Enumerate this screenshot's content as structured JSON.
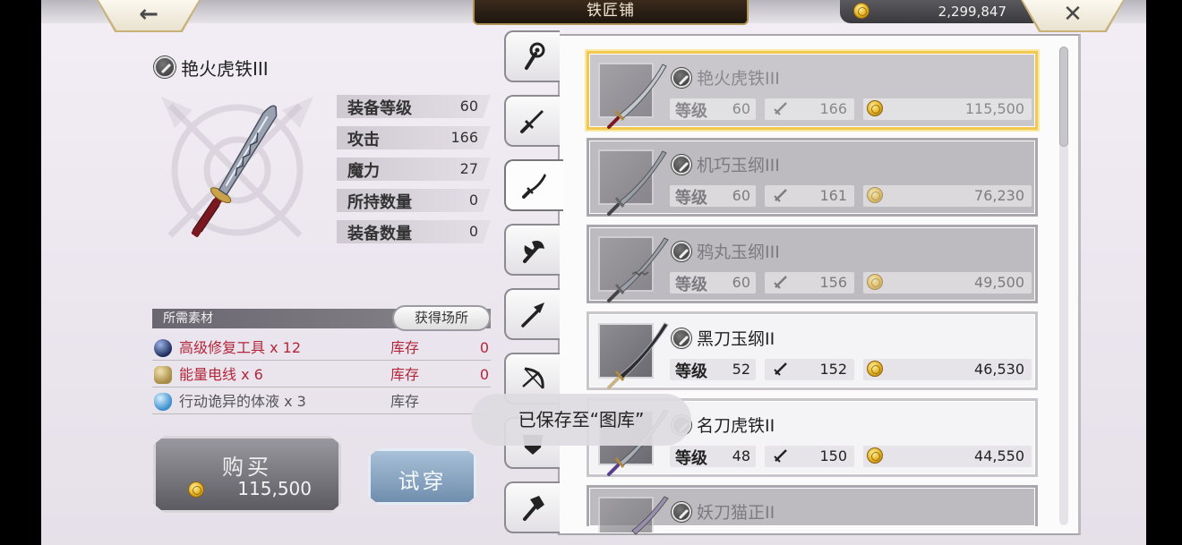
{
  "header": {
    "title": "铁匠铺",
    "back_icon": "left-arrow-icon",
    "close_icon": "close-x-icon",
    "currency": "2,299,847"
  },
  "selected_item": {
    "name": "艳火虎铁III",
    "stats": [
      {
        "label": "装备等级",
        "value": "60"
      },
      {
        "label": "攻击",
        "value": "166"
      },
      {
        "label": "魔力",
        "value": "27"
      },
      {
        "label": "所持数量",
        "value": "0"
      },
      {
        "label": "装备数量",
        "value": "0"
      }
    ]
  },
  "materials": {
    "header": "所需素材",
    "obtain_button": "获得场所",
    "items": [
      {
        "name": "高级修复工具 x 12",
        "stock_label": "库存",
        "count": "0"
      },
      {
        "name": "能量电线 x 6",
        "stock_label": "库存",
        "count": "0"
      },
      {
        "name": "行动诡异的体液 x 3",
        "stock_label": "库存",
        "count": ""
      }
    ]
  },
  "actions": {
    "buy_label": "购买",
    "buy_price": "115,500",
    "try_label": "试穿"
  },
  "tabs": [
    "staff-icon",
    "sword-icon",
    "katana-icon",
    "axe-icon",
    "spear-icon",
    "bow-icon",
    "shield-icon",
    "hammer-icon"
  ],
  "weapon_list": [
    {
      "name": "艳火虎铁III",
      "level_label": "等级",
      "level": "60",
      "attack": "166",
      "price": "115,500",
      "state": "selected"
    },
    {
      "name": "机巧玉纲III",
      "level_label": "等级",
      "level": "60",
      "attack": "161",
      "price": "76,230",
      "state": "locked"
    },
    {
      "name": "鸦丸玉纲III",
      "level_label": "等级",
      "level": "60",
      "attack": "156",
      "price": "49,500",
      "state": "locked"
    },
    {
      "name": "黑刀玉纲II",
      "level_label": "等级",
      "level": "52",
      "attack": "152",
      "price": "46,530",
      "state": "available"
    },
    {
      "name": "名刀虎铁II",
      "level_label": "等级",
      "level": "48",
      "attack": "150",
      "price": "44,550",
      "state": "available"
    },
    {
      "name": "妖刀猫正II",
      "level_label": "",
      "level": "",
      "attack": "",
      "price": "",
      "state": "locked"
    }
  ],
  "toast": "已保存至“图库”"
}
